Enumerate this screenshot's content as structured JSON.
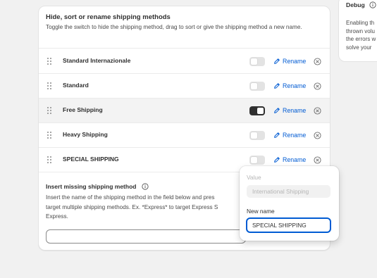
{
  "card": {
    "title": "Hide, sort or rename shipping methods",
    "description": "Toggle the switch to hide the shipping method, drag to sort or give the shipping method a new name."
  },
  "methods": [
    {
      "label": "Standard Internazionale",
      "hidden": false,
      "rename_label": "Rename"
    },
    {
      "label": "Standard",
      "hidden": false,
      "rename_label": "Rename"
    },
    {
      "label": "Free Shipping",
      "hidden": true,
      "rename_label": "Rename"
    },
    {
      "label": "Heavy Shipping",
      "hidden": false,
      "rename_label": "Rename"
    },
    {
      "label": "SPECIAL SHIPPING",
      "hidden": false,
      "rename_label": "Rename"
    }
  ],
  "missing": {
    "title": "Insert missing shipping method",
    "line1": "Insert the name of the shipping method in the field below and pres",
    "line2": "target multiple shipping methods. Ex. *Express* to target Express S",
    "line3": "Express.",
    "input_value": ""
  },
  "rename_popover": {
    "value_label": "Value",
    "value": "International Shipping",
    "new_name_label": "New name",
    "new_name_value": "SPECIAL SHIPPING"
  },
  "debug": {
    "title": "Debug",
    "line1": "Enabling th",
    "line2": "thrown volu",
    "line3": "the errors w",
    "line4": "solve your"
  },
  "colors": {
    "accent": "#005bd3",
    "toggle_on": "#303030",
    "toggle_off": "#e3e3e3",
    "background": "#f1f1f1"
  }
}
